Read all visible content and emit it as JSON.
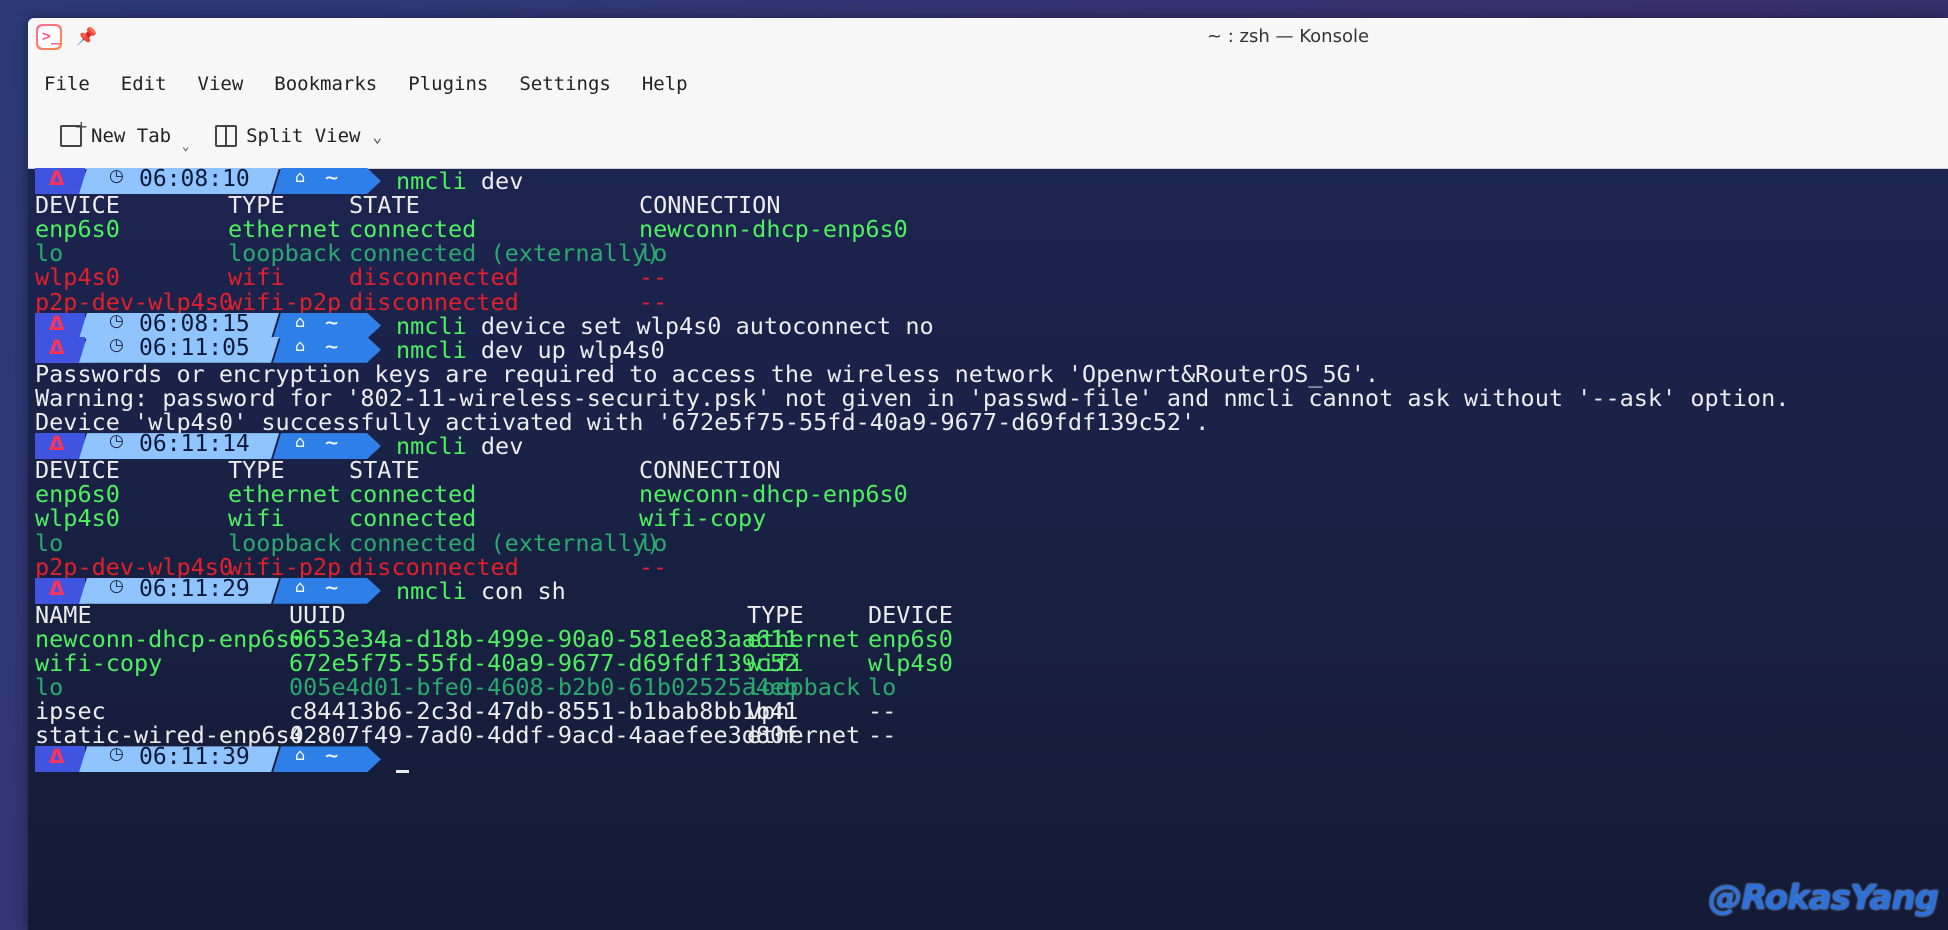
{
  "window": {
    "title": "~ : zsh — Konsole"
  },
  "menu": [
    "File",
    "Edit",
    "View",
    "Bookmarks",
    "Plugins",
    "Settings",
    "Help"
  ],
  "toolbar": {
    "new_tab": "New Tab",
    "split_view": "Split View"
  },
  "prompt": {
    "arch_icon": "arch-logo-icon",
    "clock_icon": "clock-icon",
    "home_icon": "home-icon",
    "dir": "~"
  },
  "blocks": {
    "p1": {
      "time": "06:08:10",
      "cmd_name": "nmcli",
      "cmd_args": " dev"
    },
    "dev1": {
      "header": [
        "DEVICE",
        "TYPE",
        "STATE",
        "CONNECTION"
      ],
      "rows": [
        [
          "enp6s0",
          "ethernet",
          "connected",
          "newconn-dhcp-enp6s0"
        ],
        [
          "lo",
          "loopback",
          "connected (externally)",
          "lo"
        ],
        [
          "wlp4s0",
          "wifi",
          "disconnected",
          "--"
        ],
        [
          "p2p-dev-wlp4s0",
          "wifi-p2p",
          "disconnected",
          "--"
        ]
      ]
    },
    "p2": {
      "time": "06:08:15",
      "cmd_name": "nmcli",
      "cmd_args": " device set wlp4s0 autoconnect no"
    },
    "p3": {
      "time": "06:11:05",
      "cmd_name": "nmcli",
      "cmd_args": " dev up wlp4s0"
    },
    "out3": [
      "Passwords or encryption keys are required to access the wireless network 'Openwrt&RouterOS_5G'.",
      "Warning: password for '802-11-wireless-security.psk' not given in 'passwd-file' and nmcli cannot ask without '--ask' option.",
      "Device 'wlp4s0' successfully activated with '672e5f75-55fd-40a9-9677-d69fdf139c52'."
    ],
    "p4": {
      "time": "06:11:14",
      "cmd_name": "nmcli",
      "cmd_args": " dev"
    },
    "dev2": {
      "header": [
        "DEVICE",
        "TYPE",
        "STATE",
        "CONNECTION"
      ],
      "rows": [
        [
          "enp6s0",
          "ethernet",
          "connected",
          "newconn-dhcp-enp6s0"
        ],
        [
          "wlp4s0",
          "wifi",
          "connected",
          "wifi-copy"
        ],
        [
          "lo",
          "loopback",
          "connected (externally)",
          "lo"
        ],
        [
          "p2p-dev-wlp4s0",
          "wifi-p2p",
          "disconnected",
          "--"
        ]
      ]
    },
    "p5": {
      "time": "06:11:29",
      "cmd_name": "nmcli",
      "cmd_args": " con sh"
    },
    "con": {
      "header": [
        "NAME",
        "UUID",
        "TYPE",
        "DEVICE"
      ],
      "rows": [
        [
          "newconn-dhcp-enp6s0",
          "6653e34a-d18b-499e-90a0-581ee83aa611",
          "ethernet",
          "enp6s0"
        ],
        [
          "wifi-copy",
          "672e5f75-55fd-40a9-9677-d69fdf139c52",
          "wifi",
          "wlp4s0"
        ],
        [
          "lo",
          "005e4d01-bfe0-4608-b2b0-61b02525a4eb",
          "loopback",
          "lo"
        ],
        [
          "ipsec",
          "c84413b6-2c3d-47db-8551-b1bab8bb1b41",
          "vpn",
          "--"
        ],
        [
          "static-wired-enp6s0",
          "42807f49-7ad0-4ddf-9acd-4aaefee3d80f",
          "ethernet",
          "--"
        ]
      ]
    },
    "p6": {
      "time": "06:11:39"
    }
  },
  "colors": {
    "connected": "#4ef060",
    "external": "#2aa86e",
    "disconnected": "#e0202a",
    "plain": "#ececec"
  },
  "watermark": "@RokasYang"
}
